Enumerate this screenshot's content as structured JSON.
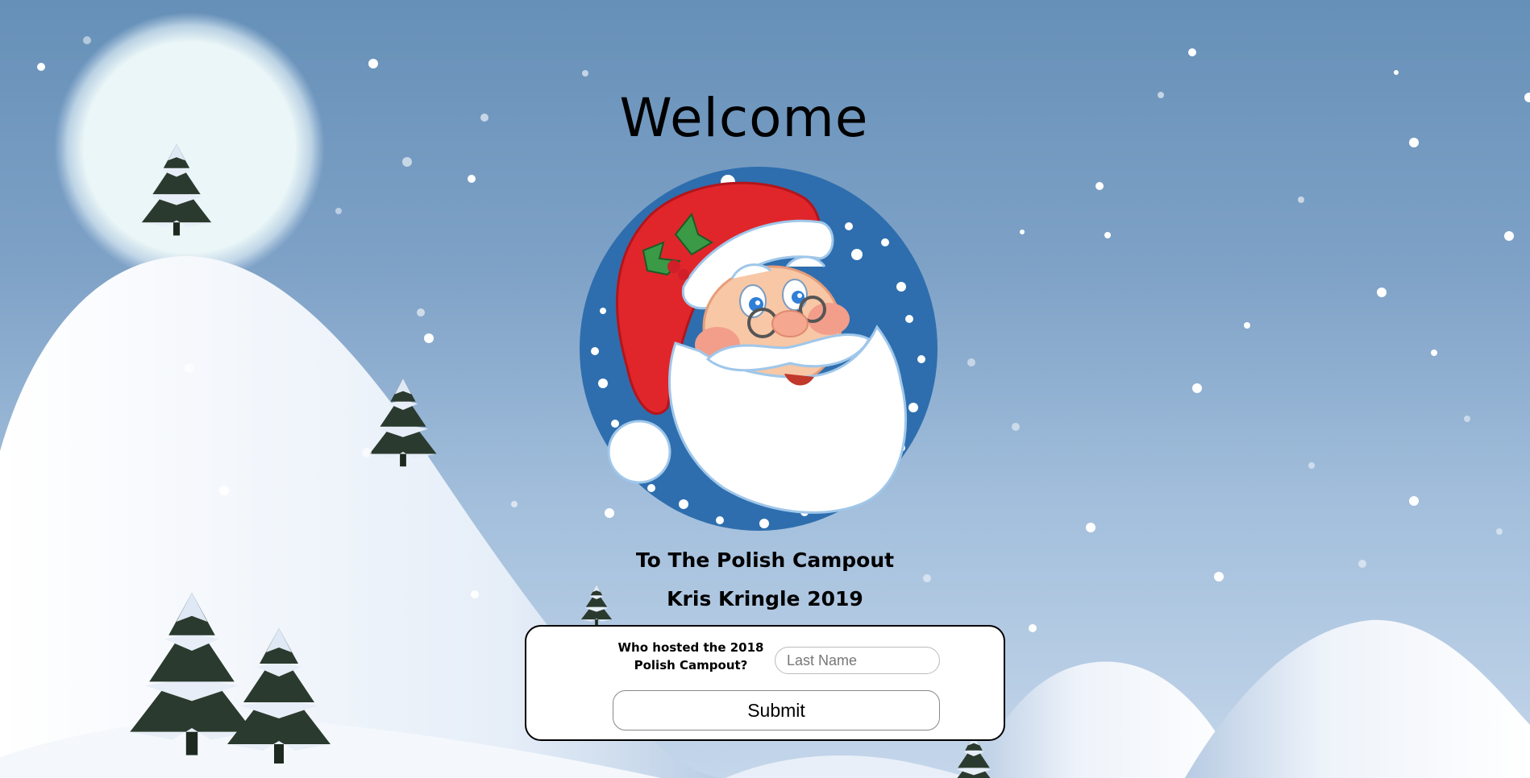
{
  "page": {
    "title": "Welcome",
    "subtitle_line1": "To The Polish Campout",
    "subtitle_line2": "Kris Kringle 2019"
  },
  "form": {
    "question": "Who hosted the 2018 Polish Campout?",
    "input_placeholder": "Last Name",
    "input_value": "",
    "submit_label": "Submit"
  },
  "colors": {
    "sky_top": "#6690b8",
    "sky_bottom": "#c4d6ea",
    "moon": "#eaf6f7",
    "snow": "#f2f6fb",
    "tree": "#2b3a2e",
    "santa_badge": "#2e6eae",
    "santa_hat": "#e0262b"
  },
  "icons": {
    "logo": "santa-face-icon",
    "moon": "moon-icon",
    "tree": "pine-tree-icon"
  }
}
